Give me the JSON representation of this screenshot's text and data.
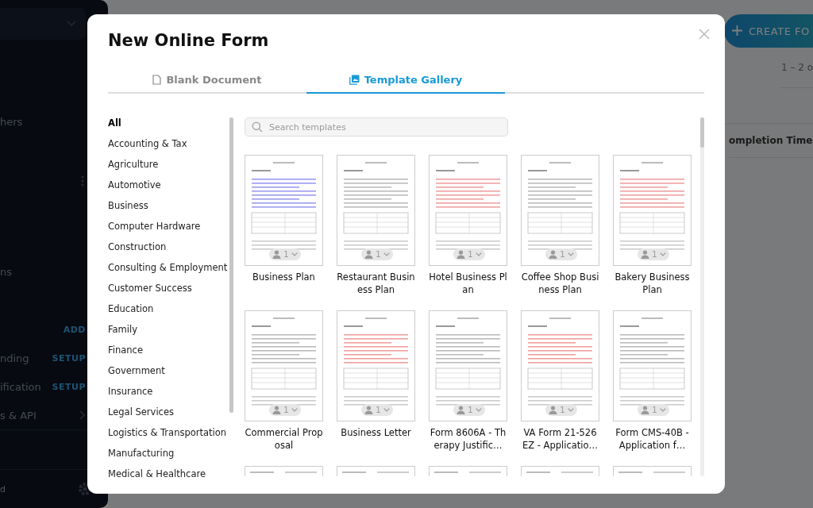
{
  "background": {
    "sidebar": {
      "items": [
        {
          "label": "hers",
          "kind": "text"
        },
        {
          "label": "ns",
          "kind": "text"
        },
        {
          "label": "ADD",
          "kind": "action"
        },
        {
          "label": "nding",
          "kind": "setup",
          "action": "SETUP"
        },
        {
          "label": "ification",
          "kind": "setup",
          "action": "SETUP"
        },
        {
          "label": "s & API",
          "kind": "link"
        }
      ],
      "footer": "d"
    },
    "create_button": "CREATE FO",
    "pagination": "1 – 2 o",
    "column_header": "ompletion Time"
  },
  "dialog": {
    "title": "New Online Form",
    "tabs": [
      {
        "label": "Blank Document",
        "selected": false
      },
      {
        "label": "Template Gallery",
        "selected": true
      }
    ],
    "categories": [
      {
        "label": "All",
        "selected": true
      },
      {
        "label": "Accounting & Tax",
        "selected": false
      },
      {
        "label": "Agriculture",
        "selected": false
      },
      {
        "label": "Automotive",
        "selected": false
      },
      {
        "label": "Business",
        "selected": false
      },
      {
        "label": "Computer Hardware",
        "selected": false
      },
      {
        "label": "Construction",
        "selected": false
      },
      {
        "label": "Consulting & Employment",
        "selected": false
      },
      {
        "label": "Customer Success",
        "selected": false
      },
      {
        "label": "Education",
        "selected": false
      },
      {
        "label": "Family",
        "selected": false
      },
      {
        "label": "Finance",
        "selected": false
      },
      {
        "label": "Government",
        "selected": false
      },
      {
        "label": "Insurance",
        "selected": false
      },
      {
        "label": "Legal Services",
        "selected": false
      },
      {
        "label": "Logistics & Transportation",
        "selected": false
      },
      {
        "label": "Manufacturing",
        "selected": false
      },
      {
        "label": "Medical & Healthcare",
        "selected": false
      }
    ],
    "search": {
      "placeholder": "Search templates"
    },
    "templates": [
      {
        "kind": "full",
        "name": "Business Plan",
        "users": "1"
      },
      {
        "kind": "full",
        "name": "Restaurant Business Plan",
        "users": "1"
      },
      {
        "kind": "full",
        "name": "Hotel Business Plan",
        "users": "1"
      },
      {
        "kind": "full",
        "name": "Coffee Shop Business Plan",
        "users": "1"
      },
      {
        "kind": "full",
        "name": "Bakery Business Plan",
        "users": "1"
      },
      {
        "kind": "full",
        "name": "Commercial Proposal",
        "users": "1"
      },
      {
        "kind": "full",
        "name": "Business Letter",
        "users": "1"
      },
      {
        "kind": "full",
        "name": "Form 8606A - Therapy Justific…",
        "users": "1"
      },
      {
        "kind": "full",
        "name": "VA Form 21-526 EZ - Applicatio…",
        "users": "1"
      },
      {
        "kind": "full",
        "name": "Form CMS-40B - Application f…",
        "users": "1"
      },
      {
        "kind": "peek"
      },
      {
        "kind": "peek"
      },
      {
        "kind": "peek"
      },
      {
        "kind": "peek"
      },
      {
        "kind": "peek"
      }
    ]
  }
}
